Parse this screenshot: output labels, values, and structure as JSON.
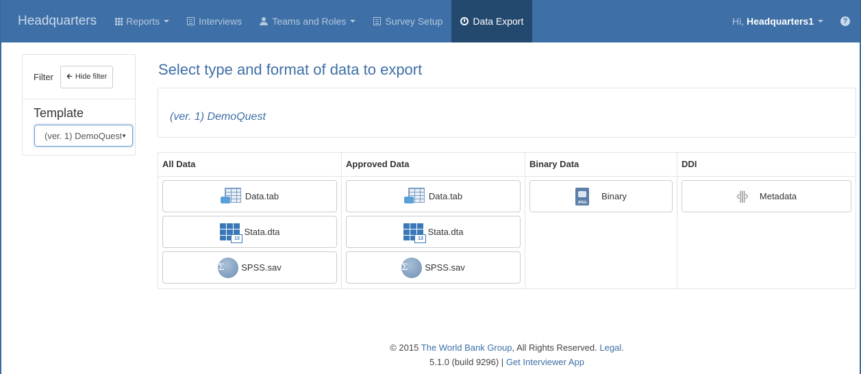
{
  "navbar": {
    "brand": "Headquarters",
    "items": [
      {
        "label": "Reports",
        "icon": "grid-icon",
        "dropdown": true
      },
      {
        "label": "Interviews",
        "icon": "list-icon",
        "dropdown": false
      },
      {
        "label": "Teams and Roles",
        "icon": "person-icon",
        "dropdown": true
      },
      {
        "label": "Survey Setup",
        "icon": "list-icon",
        "dropdown": false
      },
      {
        "label": "Data Export",
        "icon": "clock-icon",
        "dropdown": false,
        "active": true
      }
    ],
    "greeting": "Hi,",
    "username": "Headquarters1",
    "help_icon": "?"
  },
  "sidebar": {
    "filter_label": "Filter",
    "hide_filter_button": "Hide filter",
    "template_label": "Template",
    "template_selected": "(ver. 1) DemoQuest"
  },
  "main": {
    "title": "Select type and format of data to export",
    "questionnaire": "(ver. 1) DemoQuest",
    "columns": [
      {
        "header": "All Data",
        "buttons": [
          "Data.tab",
          "Stata.dta",
          "SPSS.sav"
        ]
      },
      {
        "header": "Approved Data",
        "buttons": [
          "Data.tab",
          "Stata.dta",
          "SPSS.sav"
        ]
      },
      {
        "header": "Binary Data",
        "buttons": [
          "Binary"
        ]
      },
      {
        "header": "DDI",
        "buttons": [
          "Metadata"
        ]
      }
    ]
  },
  "footer": {
    "copyright": "© 2015",
    "org_link": "The World Bank Group",
    "rights": ", All Rights Reserved.",
    "legal_link": "Legal.",
    "version": "5.1.0 (build 9296) |",
    "app_link": "Get Interviewer App"
  },
  "colors": {
    "navbar": "#3e6fa6",
    "navbar_active": "#23496f",
    "accent_text": "#3e6fa6"
  }
}
